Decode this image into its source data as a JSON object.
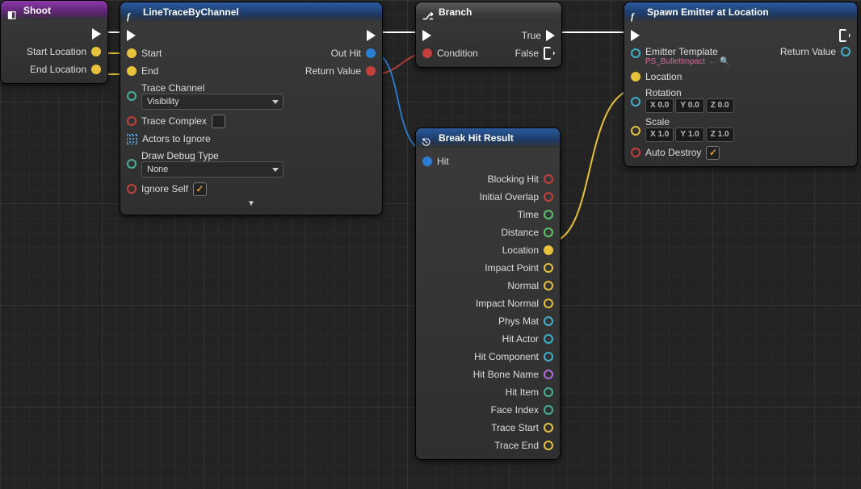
{
  "nodes": {
    "shoot": {
      "title": "Shoot",
      "outputs": [
        "Start Location",
        "End Location"
      ]
    },
    "trace": {
      "title": "LineTraceByChannel",
      "pins": {
        "start": "Start",
        "end": "End",
        "traceChannel": "Trace Channel",
        "visibility": "Visibility",
        "traceComplex": "Trace Complex",
        "actorsIgnore": "Actors to Ignore",
        "drawDebug": "Draw Debug Type",
        "none": "None",
        "ignoreSelf": "Ignore Self",
        "outHit": "Out Hit",
        "returnValue": "Return Value"
      }
    },
    "branch": {
      "title": "Branch",
      "condition": "Condition",
      "true": "True",
      "false": "False"
    },
    "breakhit": {
      "title": "Break Hit Result",
      "hit": "Hit",
      "outs": [
        "Blocking Hit",
        "Initial Overlap",
        "Time",
        "Distance",
        "Location",
        "Impact Point",
        "Normal",
        "Impact Normal",
        "Phys Mat",
        "Hit Actor",
        "Hit Component",
        "Hit Bone Name",
        "Hit Item",
        "Face Index",
        "Trace Start",
        "Trace End"
      ],
      "pinColors": [
        "c-red",
        "c-red",
        "c-green",
        "c-green",
        "c-yellow",
        "c-yellow",
        "c-yellow",
        "c-yellow",
        "c-cyan",
        "c-cyan",
        "c-cyan",
        "c-purple",
        "c-teal",
        "c-teal",
        "c-yellow",
        "c-yellow"
      ],
      "filled": [
        false,
        false,
        false,
        false,
        true,
        false,
        false,
        false,
        false,
        false,
        false,
        false,
        false,
        false,
        false,
        false
      ]
    },
    "spawn": {
      "title": "Spawn Emitter at Location",
      "emitter": "Emitter Template",
      "asset": "PS_BulletImpact",
      "location": "Location",
      "rotation": "Rotation",
      "scale": "Scale",
      "autoDestroy": "Auto Destroy",
      "returnValue": "Return Value",
      "rot": [
        "X",
        "0.0",
        "Y",
        "0.0",
        "Z",
        "0.0"
      ],
      "scl": [
        "X",
        "1.0",
        "Y",
        "1.0",
        "Z",
        "1.0"
      ]
    }
  }
}
